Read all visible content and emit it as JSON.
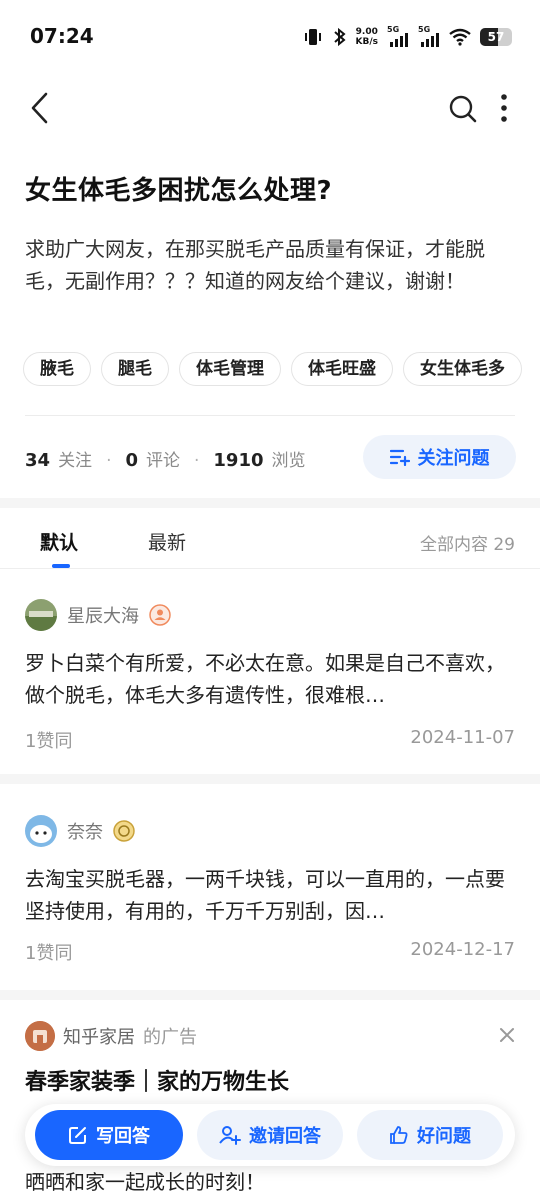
{
  "status_bar": {
    "time": "07:24",
    "net_speed_value": "9.00",
    "net_speed_unit": "KB/s",
    "signal1_label": "5G",
    "signal2_label": "5G",
    "battery": "57"
  },
  "question": {
    "title": "女生体毛多困扰怎么处理?",
    "description": "求助广大网友，在那买脱毛产品质量有保证，才能脱毛，无副作用？？？知道的网友给个建议，谢谢！",
    "tags": [
      "腋毛",
      "腿毛",
      "体毛管理",
      "体毛旺盛",
      "女生体毛多"
    ],
    "stats": {
      "followers_count": "34",
      "followers_label": "关注",
      "comments_count": "0",
      "comments_label": "评论",
      "views_count": "1910",
      "views_label": "浏览"
    },
    "follow_button_label": "关注问题"
  },
  "tabs": {
    "default_label": "默认",
    "latest_label": "最新",
    "total_label": "全部内容 29"
  },
  "answers": [
    {
      "author": "星辰大海",
      "text": "罗卜白菜个有所爱，不必太在意。如果是自己不喜欢，做个脱毛，体毛大多有遗传性，很难根…",
      "likes": "1赞同",
      "date": "2024-11-07"
    },
    {
      "author": "奈奈",
      "text": "去淘宝买脱毛器，一两千块钱，可以一直用的，一点要坚持使用，有用的，千万千万别刮，因…",
      "likes": "1赞同",
      "date": "2024-12-17"
    }
  ],
  "ad": {
    "brand": "知乎家居",
    "suffix": "的广告",
    "title": "春季家装季｜家的万物生长",
    "text": "晒晒和家一起成长的时刻！"
  },
  "action_bar": {
    "write_label": "写回答",
    "invite_label": "邀请回答",
    "good_question_label": "好问题"
  },
  "colors": {
    "accent": "#1966ff",
    "accent_soft": "#eef3fb",
    "separator_band": "#f5f5f5"
  }
}
